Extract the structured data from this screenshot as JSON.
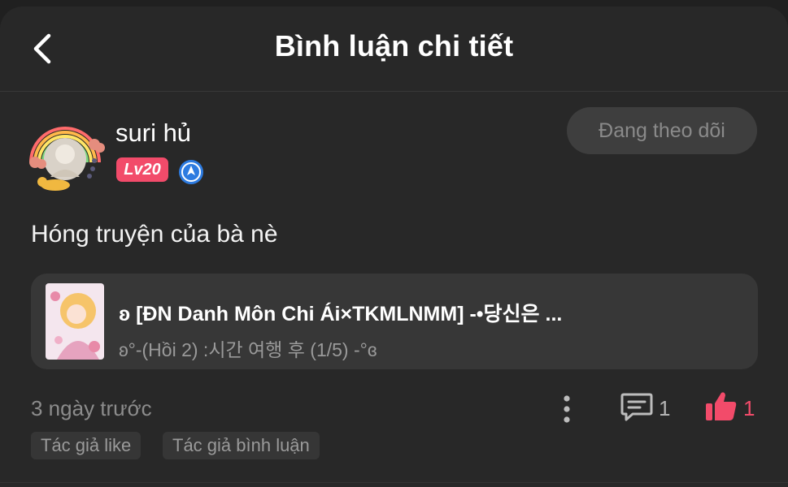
{
  "header": {
    "title": "Bình luận chi tiết"
  },
  "user": {
    "name": "suri hủ",
    "level": "Lv20",
    "follow_label": "Đang theo dõi"
  },
  "comment": {
    "text": "Hóng truyện của bà nè"
  },
  "story": {
    "title": "ʚ [ĐN Danh Môn Chi Ái×TKMLNMM] -•당신은 ...",
    "subtitle": "ʚ°-(Hồi 2) :시간 여행 후 (1/5) -°ɞ"
  },
  "meta": {
    "time": "3 ngày trước",
    "comment_count": "1",
    "like_count": "1"
  },
  "tags": [
    "Tác giả like",
    "Tác giả bình luận"
  ],
  "colors": {
    "accent": "#f24b6a",
    "badge_blue": "#2d7be0",
    "background": "#282828"
  },
  "icons": [
    "back-arrow-icon",
    "verified-badge-icon",
    "more-vertical-icon",
    "comment-icon",
    "thumbs-up-icon"
  ]
}
